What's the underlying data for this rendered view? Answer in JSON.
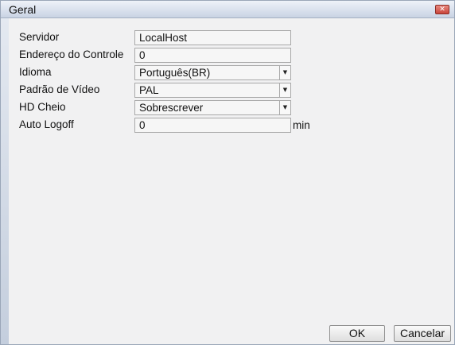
{
  "window": {
    "title": "Geral",
    "close_glyph": "✕"
  },
  "form": {
    "servidor": {
      "label": "Servidor",
      "value": "LocalHost"
    },
    "endereco": {
      "label": "Endereço do Controle",
      "value": "0"
    },
    "idioma": {
      "label": "Idioma",
      "value": "Português(BR)"
    },
    "padrao_video": {
      "label": "Padrão de Vídeo",
      "value": "PAL"
    },
    "hd_cheio": {
      "label": "HD Cheio",
      "value": "Sobrescrever"
    },
    "auto_logoff": {
      "label": "Auto Logoff",
      "value": "0",
      "unit": "min"
    }
  },
  "dropdown_glyph": "▼",
  "buttons": {
    "ok": "OK",
    "cancel": "Cancelar"
  }
}
